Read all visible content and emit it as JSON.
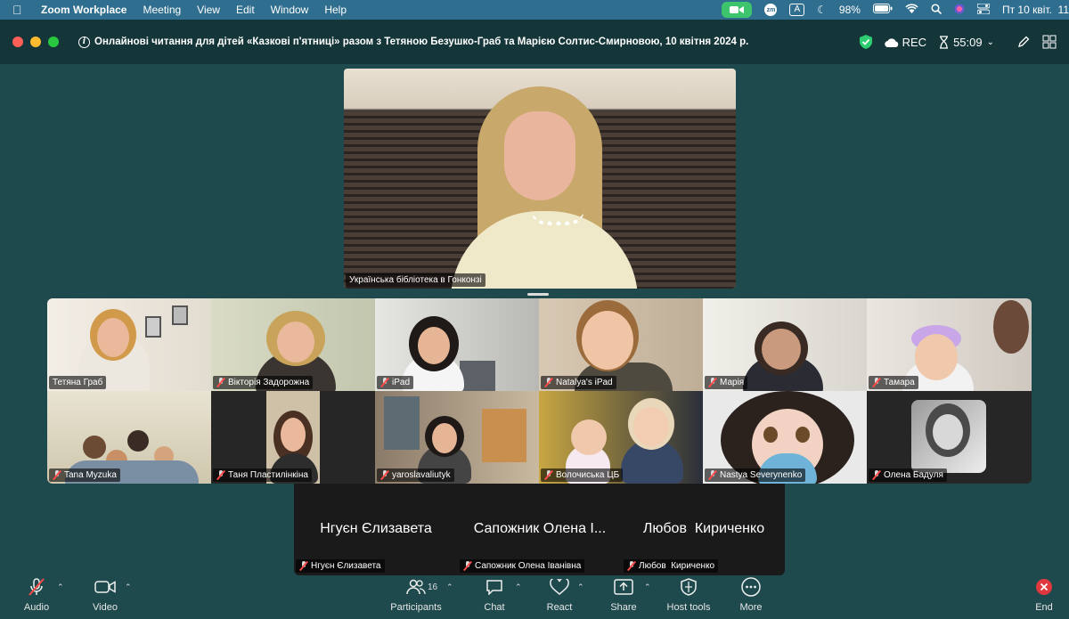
{
  "menubar": {
    "app_name": "Zoom Workplace",
    "items": [
      "Meeting",
      "View",
      "Edit",
      "Window",
      "Help"
    ],
    "battery": "98%",
    "input_badge": "A",
    "zm_badge": "zm",
    "clock": "Пт 10 квіт.  11"
  },
  "window": {
    "title": "Онлайнові читання для дітей «Казкові п'ятниці» разом з Тетяною Безушко-Граб та Марією Солтис-Смирновою, 10 квітня 2024 р.",
    "rec_label": "REC",
    "timer": "55:09"
  },
  "speaker": {
    "name": "Українська бібліотека в Гонконзі"
  },
  "gallery": [
    {
      "name": "Тетяна Граб",
      "muted": false
    },
    {
      "name": "Вікторія Задорожна",
      "muted": true
    },
    {
      "name": "iPad",
      "muted": true
    },
    {
      "name": "Natalya's iPad",
      "muted": true
    },
    {
      "name": "Марія",
      "muted": true
    },
    {
      "name": "Тамара",
      "muted": true
    },
    {
      "name": "Tana Myzuka",
      "muted": true
    },
    {
      "name": "Таня Пластилінкіна",
      "muted": true
    },
    {
      "name": "yaroslavaliutyk",
      "muted": true
    },
    {
      "name": "Волочиська ЦБ",
      "muted": true
    },
    {
      "name": "Nastya Severynenko",
      "muted": true
    },
    {
      "name": "Олена Бадуля",
      "muted": true
    }
  ],
  "name_tiles": [
    {
      "display": "Нгуєн Єлизавета",
      "tag": "Нгуєн Єлизавета"
    },
    {
      "display": "Сапожник Олена І...",
      "tag": "Сапожник Олена Іванівна"
    },
    {
      "display": "Любов  Кириченко",
      "tag": "Любов  Кириченко"
    }
  ],
  "toolbar": {
    "audio": "Audio",
    "video": "Video",
    "participants": "Participants",
    "participants_count": "16",
    "chat": "Chat",
    "react": "React",
    "share": "Share",
    "host_tools": "Host tools",
    "more": "More",
    "end": "End"
  },
  "colors": {
    "background": "#1e4a4d",
    "titlebar": "#143638",
    "menubar": "#2f6e8f",
    "end_icon": "#e0383e",
    "secure_shield": "#2ecc71"
  }
}
